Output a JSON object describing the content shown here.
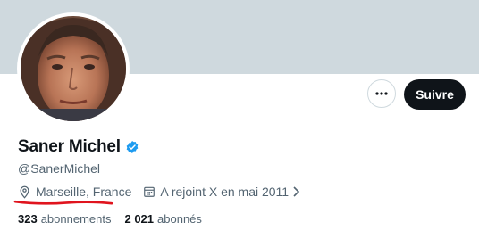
{
  "profile": {
    "name": "Saner Michel",
    "handle": "@SanerMichel",
    "location": "Marseille, France",
    "joined": "A rejoint X en mai 2011",
    "verified": true
  },
  "actions": {
    "more_icon": "more-horizontal-icon",
    "follow_label": "Suivre"
  },
  "stats": {
    "following_count": "323",
    "following_label": "abonnements",
    "followers_count": "2 021",
    "followers_label": "abonnés"
  },
  "icons": {
    "location": "location-pin-icon",
    "calendar": "calendar-icon",
    "verified": "verified-badge-icon",
    "chevron": "chevron-right-icon"
  },
  "colors": {
    "banner": "#cfd9de",
    "verified_blue": "#1d9bf0",
    "follow_button_bg": "#0f1419",
    "secondary_text": "#536471",
    "annotation_red": "#e0141e"
  }
}
